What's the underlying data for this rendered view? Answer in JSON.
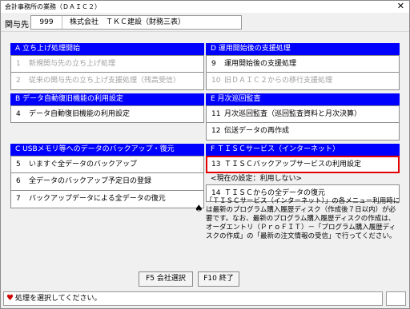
{
  "window": {
    "title": "会計事務所の業務（ＤＡＩＣ２）",
    "close": "✕"
  },
  "client": {
    "label": "関与先",
    "code": "999",
    "name": "株式会社　ＴＫＣ建設（財務三表）"
  },
  "sections": {
    "a": {
      "header": "A 立ち上げ処理開始",
      "items": [
        {
          "num": "1",
          "label": "新規関与先の立ち上げ処理"
        },
        {
          "num": "2",
          "label": "従来の関与先の立ち上げ支援処理（残高受信）"
        }
      ]
    },
    "b": {
      "header": "B データ自動復旧機能の利用設定",
      "items": [
        {
          "num": "4",
          "label": "データ自動復旧機能の利用設定"
        }
      ]
    },
    "c": {
      "header": "C USBメモリ等へのデータのバックアップ・復元",
      "items": [
        {
          "num": "5",
          "label": "いますぐ全データのバックアップ"
        },
        {
          "num": "6",
          "label": "全データのバックアップ予定日の登録"
        },
        {
          "num": "7",
          "label": "バックアップデータによる全データの復元"
        }
      ]
    },
    "d": {
      "header": "D 運用開始後の支援処理",
      "items": [
        {
          "num": "9",
          "label": "運用開始後の支援処理"
        },
        {
          "num": "10",
          "label": "旧ＤＡＩＣ２からの移行支援処理"
        }
      ]
    },
    "e": {
      "header": "E 月次巡回監査",
      "items": [
        {
          "num": "11",
          "label": "月次巡回監査（巡回監査資料と月次決算）"
        },
        {
          "num": "12",
          "label": "伝送データの再作成"
        }
      ]
    },
    "f": {
      "header": "F ＴＩＳＣサービス（インターネット）",
      "items": [
        {
          "num": "13",
          "label": "ＴＩＳＣバックアップサービスの利用設定"
        },
        {
          "num": "14",
          "label": "ＴＩＳＣからの全データの復元"
        }
      ],
      "current_setting": "<現在の設定：利用しない>"
    }
  },
  "notice": {
    "icon": "spade-icon",
    "text": "「ＴＩＳＣサービス（インターネット）」の各メニュー利用時には最新のプログラム購入履歴ディスク（作成後７日以内）が必要です。なお、最新のプログラム購入履歴ディスクの作成は、オーダエントリ（ＰｒｏＦＩＴ）－「プログラム購入履歴ディスクの作成」の「最新の注文情報の受信」で行ってください。"
  },
  "buttons": {
    "f5": "F5 会社選択",
    "f10": "F10 終了"
  },
  "status": {
    "message": "処理を選択してください。"
  },
  "colors": {
    "section_header": "#0000ff",
    "highlight_border": "#e00000",
    "disabled_text": "#a0a0a0"
  }
}
